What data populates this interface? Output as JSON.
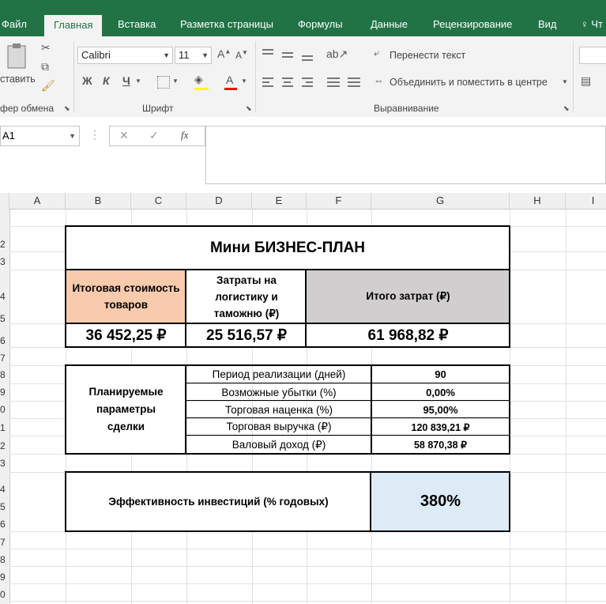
{
  "ribbon": {
    "tabs": [
      "Файл",
      "Главная",
      "Вставка",
      "Разметка страницы",
      "Формулы",
      "Данные",
      "Рецензирование",
      "Вид",
      "Чт"
    ],
    "paste_label": "ставить",
    "clipboard_group": "фер обмена",
    "font_group": "Шрифт",
    "align_group": "Выравнивание",
    "font_name": "Calibri",
    "font_size": "11",
    "bold": "Ж",
    "italic": "К",
    "underline": "Ч",
    "wrap_text": "Перенести текст",
    "merge_center": "Объединить и поместить в центре"
  },
  "formula_bar": {
    "name_box": "A1",
    "fx": "fx",
    "formula": ""
  },
  "columns": [
    "A",
    "B",
    "C",
    "D",
    "E",
    "F",
    "G",
    "H",
    "I"
  ],
  "rows": [
    "2",
    "3",
    "4",
    "5",
    "6",
    "7",
    "8",
    "9",
    "0",
    "1",
    "2",
    "3",
    "4",
    "5",
    "6",
    "7",
    "8",
    "9",
    "0"
  ],
  "sheet": {
    "title": "Мини БИЗНЕС-ПЛАН",
    "goods_cost_label": "Итоговая стоимость товаров",
    "logistics_label": "Затраты на логистику и таможню (₽)",
    "total_costs_label": "Итого затрат (₽)",
    "goods_cost_value": "36 452,25 ₽",
    "logistics_value": "25 516,57 ₽",
    "total_costs_value": "61 968,82 ₽",
    "params_title": "Планируемые параметры сделки",
    "params": [
      {
        "label": "Период реализации (дней)",
        "value": "90"
      },
      {
        "label": "Возможные убытки (%)",
        "value": "0,00%"
      },
      {
        "label": "Торговая наценка (%)",
        "value": "95,00%"
      },
      {
        "label": "Торговая выручка (₽)",
        "value": "120 839,21 ₽"
      },
      {
        "label": "Валовый доход (₽)",
        "value": "58 870,38 ₽"
      }
    ],
    "efficiency_label": "Эффективность инвестиций (% годовых)",
    "efficiency_value": "380%"
  },
  "colors": {
    "excel_green": "#217346",
    "peach": "#f8cbad",
    "gray_header": "#d0cece",
    "light_blue": "#ddebf7"
  }
}
